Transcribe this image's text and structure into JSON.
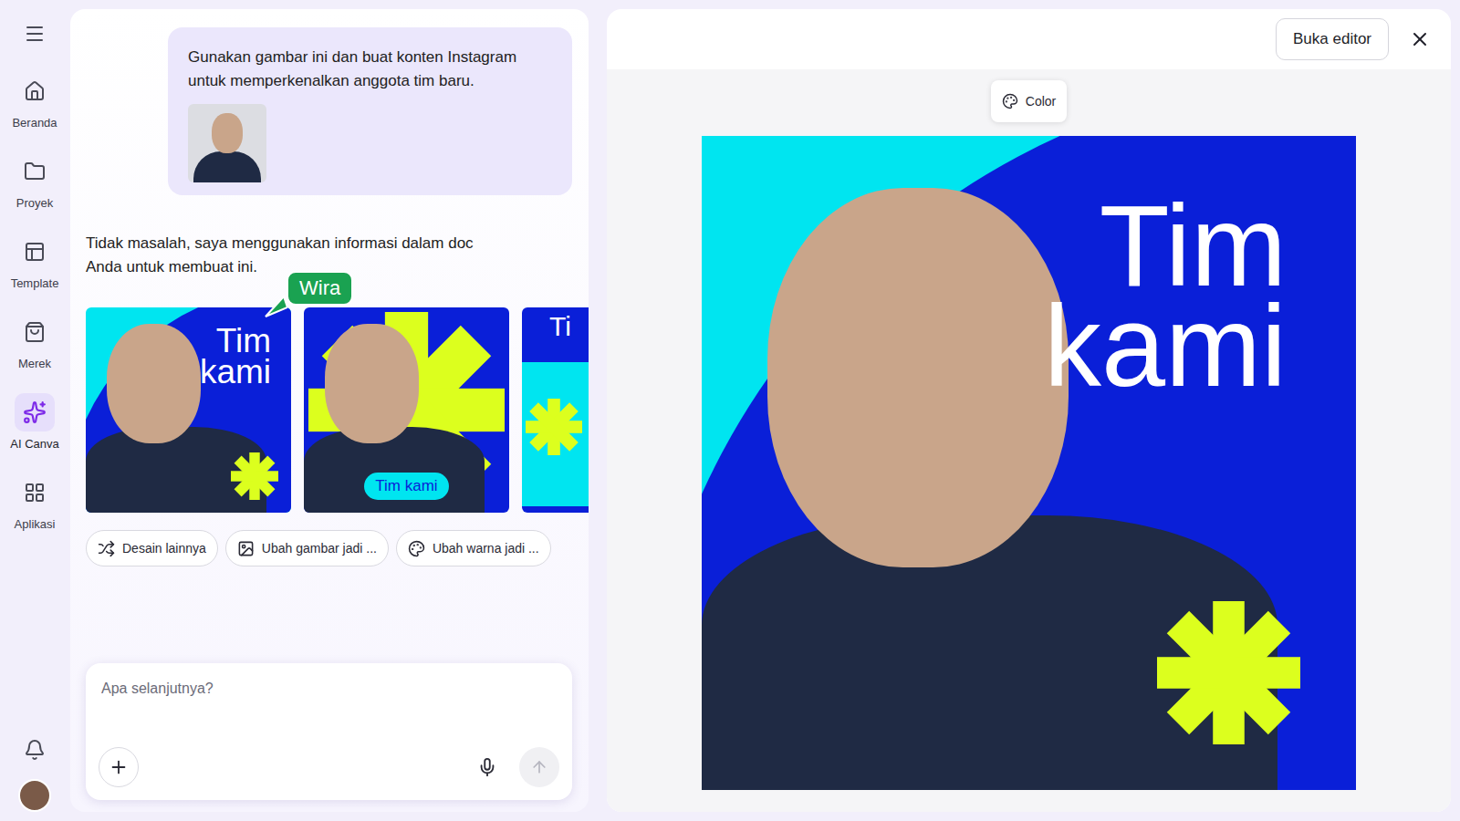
{
  "sidebar": {
    "items": [
      {
        "label": "Beranda",
        "selected": false
      },
      {
        "label": "Proyek",
        "selected": false
      },
      {
        "label": "Template",
        "selected": false
      },
      {
        "label": "Merek",
        "selected": false
      },
      {
        "label": "AI Canva",
        "selected": true
      },
      {
        "label": "Aplikasi",
        "selected": false
      }
    ]
  },
  "chat": {
    "user_message": "Gunakan gambar ini dan buat konten Instagram untuk memperkenalkan anggota tim baru.",
    "assistant_message": "Tidak masalah, saya menggunakan informasi dalam doc Anda untuk membuat ini.",
    "cursor_tag": "Wira",
    "designs": [
      {
        "kind": "corner",
        "title_lines": [
          "Tim",
          "kami"
        ]
      },
      {
        "kind": "burst",
        "title_lines": [
          "Tim kami"
        ]
      },
      {
        "kind": "partial",
        "title_lines": [
          "Ti"
        ]
      }
    ],
    "suggestions": [
      {
        "kind": "more",
        "label": "Desain lainnya"
      },
      {
        "kind": "image",
        "label": "Ubah gambar jadi ..."
      },
      {
        "kind": "color",
        "label": "Ubah warna jadi ..."
      }
    ],
    "input": {
      "placeholder": "Apa selanjutnya?"
    }
  },
  "preview": {
    "open_editor": "Buka editor",
    "color_button": "Color",
    "design": {
      "kind": "corner",
      "title_lines": [
        "Tim",
        "kami"
      ]
    }
  }
}
